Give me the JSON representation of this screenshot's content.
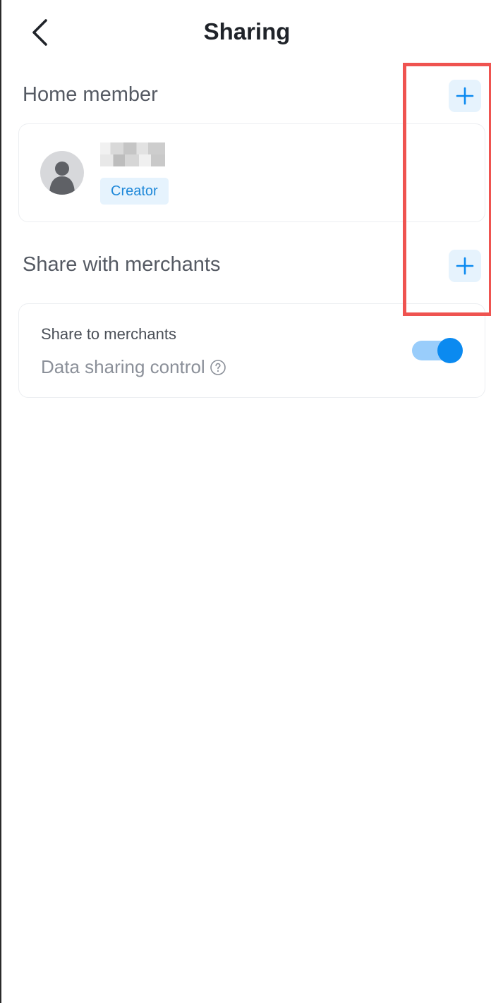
{
  "header": {
    "title": "Sharing",
    "back_icon": "chevron-left-icon"
  },
  "home_member": {
    "section_title": "Home member",
    "add_icon": "plus-icon",
    "members": [
      {
        "name": "",
        "role": "Creator",
        "avatar_icon": "user-silhouette-icon"
      }
    ]
  },
  "merchants": {
    "section_title": "Share with merchants",
    "add_icon": "plus-icon",
    "share_label": "Share to merchants",
    "control_label": "Data sharing control",
    "help_icon": "question-circle-icon",
    "toggle_enabled": true
  },
  "colors": {
    "accent": "#0b8af0",
    "accent_light": "#e6f3fd",
    "highlight": "#ef5350"
  }
}
